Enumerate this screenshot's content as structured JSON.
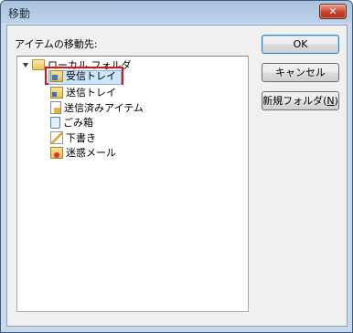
{
  "window": {
    "title": "移動",
    "close_label": "✕"
  },
  "dialog": {
    "destination_label": "アイテムの移動先:",
    "tree": {
      "root_label": "ローカル フォルダ",
      "items": [
        {
          "label": "受信トレイ",
          "icon": "inbox-icon",
          "selected": true
        },
        {
          "label": "送信トレイ",
          "icon": "outbox-icon"
        },
        {
          "label": "送信済みアイテム",
          "icon": "sent-items-icon"
        },
        {
          "label": "ごみ箱",
          "icon": "trash-icon"
        },
        {
          "label": "下書き",
          "icon": "drafts-icon"
        },
        {
          "label": "迷惑メール",
          "icon": "junk-mail-icon"
        }
      ]
    },
    "buttons": {
      "ok": "OK",
      "cancel": "キャンセル",
      "new_folder": "新規フォルダ(",
      "new_folder_key": "N",
      "new_folder_end": ")"
    }
  },
  "highlight": {
    "selection_box_color": "#e01515"
  }
}
